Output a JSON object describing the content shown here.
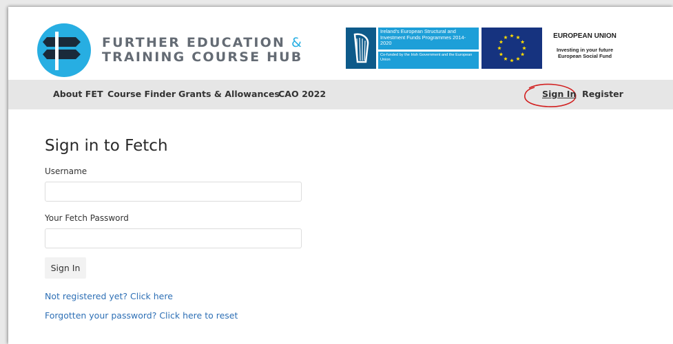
{
  "brand": {
    "line1": "FURTHER EDUCATION",
    "amp": "&",
    "line2": "TRAINING COURSE HUB"
  },
  "partner_logo": {
    "top_text": "Ireland's European Structural and Investment Funds Programmes 2014-2020",
    "bottom_text": "Co-funded by the Irish Government and the European Union"
  },
  "eu_logo": {
    "title": "EUROPEAN UNION",
    "line1": "Investing in your future",
    "line2": "European Social Fund"
  },
  "nav": {
    "items": [
      "About FET",
      "Course Finder",
      "Grants & Allowances",
      "CAO 2022"
    ],
    "sign_in": "Sign In",
    "register": "Register"
  },
  "form": {
    "title": "Sign in to Fetch",
    "username_label": "Username",
    "username_value": "",
    "password_label": "Your Fetch Password",
    "password_value": "",
    "submit_label": "Sign In",
    "register_link": "Not registered yet? Click here",
    "reset_link": "Forgotten your password? Click here to reset"
  },
  "colors": {
    "brand_blue": "#27aee2",
    "link_blue": "#2d6fb5",
    "annotation_red": "#d21f1f"
  }
}
